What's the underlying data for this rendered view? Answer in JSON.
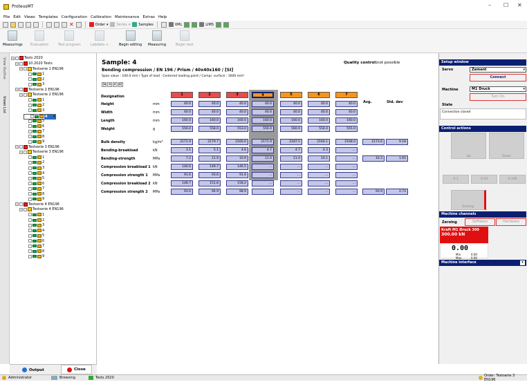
{
  "app": {
    "title": "ProteusMT",
    "window_controls": [
      "–",
      "☐",
      "✕"
    ]
  },
  "menu": [
    "File",
    "Edit",
    "Views",
    "Templates",
    "Configuration",
    "Calibration",
    "Maintenance",
    "Extras",
    "Help"
  ],
  "toolbar1": {
    "order": "Order",
    "series": "Series",
    "samples": "Samples",
    "xml": "XML",
    "lims": "LIMS"
  },
  "toolbar2": [
    {
      "label": "Measurings",
      "enabled": true
    },
    {
      "label": "Evaluation",
      "enabled": false
    },
    {
      "label": "Test program",
      "enabled": false
    },
    {
      "label": "Labdata +",
      "enabled": false
    },
    {
      "label": "Begin editing",
      "enabled": true
    },
    {
      "label": "Measuring",
      "enabled": true
    },
    {
      "label": "Begin test",
      "enabled": false
    }
  ],
  "side_tabs": {
    "view_outline": "View Outline",
    "views_list": "Views List"
  },
  "tree": {
    "root": "Tests 2020",
    "nodes": [
      {
        "label": "10.2020 Tests",
        "indent": 1,
        "kind": "red",
        "pm": "−"
      },
      {
        "label": "Testserie 1 EN196",
        "indent": 2,
        "kind": "yellow",
        "pm": "−"
      },
      {
        "label": "1",
        "indent": 3,
        "kind": "item"
      },
      {
        "label": "2",
        "indent": 3,
        "kind": "item"
      },
      {
        "label": "3",
        "indent": 3,
        "kind": "item"
      },
      {
        "label": "Testserie 2 EN196",
        "indent": 1,
        "kind": "red",
        "pm": "−"
      },
      {
        "label": "Testserie 2 EN196",
        "indent": 2,
        "kind": "yellow",
        "pm": "−"
      },
      {
        "label": "1",
        "indent": 3,
        "kind": "item"
      },
      {
        "label": "2",
        "indent": 3,
        "kind": "item"
      },
      {
        "label": "3",
        "indent": 3,
        "kind": "item"
      },
      {
        "label": "4",
        "indent": 3,
        "kind": "item",
        "selected": true
      },
      {
        "label": "5",
        "indent": 3,
        "kind": "item"
      },
      {
        "label": "6",
        "indent": 3,
        "kind": "item"
      },
      {
        "label": "7",
        "indent": 3,
        "kind": "item"
      },
      {
        "label": "8",
        "indent": 3,
        "kind": "item"
      },
      {
        "label": "9",
        "indent": 3,
        "kind": "item"
      },
      {
        "label": "Testserie 3 EN196",
        "indent": 1,
        "kind": "red",
        "pm": "−"
      },
      {
        "label": "Testserie 3 EN196",
        "indent": 2,
        "kind": "yellow",
        "pm": "−"
      },
      {
        "label": "1",
        "indent": 3,
        "kind": "item"
      },
      {
        "label": "2",
        "indent": 3,
        "kind": "item"
      },
      {
        "label": "3",
        "indent": 3,
        "kind": "item"
      },
      {
        "label": "4",
        "indent": 3,
        "kind": "item"
      },
      {
        "label": "5",
        "indent": 3,
        "kind": "item"
      },
      {
        "label": "6",
        "indent": 3,
        "kind": "item"
      },
      {
        "label": "7",
        "indent": 3,
        "kind": "item"
      },
      {
        "label": "8",
        "indent": 3,
        "kind": "item"
      },
      {
        "label": "9",
        "indent": 3,
        "kind": "item"
      },
      {
        "label": "Testserie 4 EN196",
        "indent": 1,
        "kind": "red",
        "pm": "−"
      },
      {
        "label": "Testserie 4 EN196",
        "indent": 2,
        "kind": "yellow",
        "pm": "−"
      },
      {
        "label": "1",
        "indent": 3,
        "kind": "item"
      },
      {
        "label": "2",
        "indent": 3,
        "kind": "item"
      },
      {
        "label": "3",
        "indent": 3,
        "kind": "item"
      },
      {
        "label": "4",
        "indent": 3,
        "kind": "item"
      },
      {
        "label": "5",
        "indent": 3,
        "kind": "item"
      },
      {
        "label": "6",
        "indent": 3,
        "kind": "item"
      },
      {
        "label": "7",
        "indent": 3,
        "kind": "item"
      },
      {
        "label": "8",
        "indent": 3,
        "kind": "item"
      },
      {
        "label": "9",
        "indent": 3,
        "kind": "item"
      }
    ]
  },
  "sample": {
    "title": "Sample: 4",
    "type": "Bending compression / EN 196 / Prism / 40x40x160 / [SI]",
    "span": "Span value : 100.0 mm / Type of load : Centered loading point / Compr. surface : 1600 mm²",
    "quality_label": "Quality control:",
    "quality_value": "not possible"
  },
  "grid": {
    "designation": "Designation",
    "columns": [
      "1",
      "2",
      "3",
      "4",
      "5",
      "6",
      "7"
    ],
    "column_colors": [
      "#e84c4c",
      "#e84c4c",
      "#e84c4c",
      "#f7941d",
      "#f7941d",
      "#f7941d",
      "#f7941d"
    ],
    "selected_column": 3,
    "avg_label": "Avg.",
    "std_label": "Std. dev",
    "rows": [
      {
        "name": "Height",
        "unit": "mm",
        "values": [
          "40.0",
          "40.0",
          "40.0",
          "40.0",
          "40.0",
          "40.0",
          "40.0"
        ],
        "avg": "",
        "std": ""
      },
      {
        "name": "Width",
        "unit": "mm",
        "values": [
          "40.0",
          "40.0",
          "40.0",
          "40.0",
          "40.0",
          "40.0",
          "40.0"
        ],
        "avg": "",
        "std": ""
      },
      {
        "name": "Length",
        "unit": "mm",
        "values": [
          "160.0",
          "160.0",
          "160.0",
          "160.0",
          "160.0",
          "160.0",
          "160.0"
        ],
        "avg": "",
        "std": ""
      },
      {
        "name": "Weight",
        "unit": "g",
        "values": [
          "556.0",
          "558.0",
          "553.0",
          "556.0",
          "560.0",
          "554.0",
          "555.0"
        ],
        "avg": "",
        "std": ""
      },
      {
        "name": "Bulk density",
        "unit": "kg/m³",
        "values": [
          "2171.9",
          "2179.7",
          "2160.0",
          "2171.9",
          "2187.5",
          "2164.1",
          "2168.0"
        ],
        "avg": "2173.6",
        "std": "9.18"
      },
      {
        "name": "Bending-breakload",
        "unit": "kN",
        "values": [
          "3.1",
          "5.1",
          "4.6",
          "4.7",
          "4.7",
          "4.3",
          "..."
        ],
        "avg": "",
        "std": ""
      },
      {
        "name": "Bending-strength",
        "unit": "MPa",
        "values": [
          "7.2",
          "11.9",
          "10.9",
          "11.0",
          "11.0",
          "10.1",
          "..."
        ],
        "avg": "10.3",
        "std": "1.65"
      },
      {
        "name": "Compression breakload 1",
        "unit": "kN",
        "values": [
          "146.6",
          "149.7",
          "146.5",
          "...",
          "...",
          "...",
          "..."
        ],
        "avg": "",
        "std": ""
      },
      {
        "name": "Compression strength 1",
        "unit": "MPa",
        "values": [
          "91.6",
          "93.6",
          "91.6",
          "...",
          "...",
          "...",
          "..."
        ],
        "avg": "",
        "std": ""
      },
      {
        "name": "Compression breakload 2",
        "unit": "kN",
        "values": [
          "148.7",
          "151.8",
          "158.2",
          "...",
          "...",
          "...",
          "..."
        ],
        "avg": "",
        "std": ""
      },
      {
        "name": "Compression strength 2",
        "unit": "MPa",
        "values": [
          "93.0",
          "94.9",
          "98.9",
          "...",
          "...",
          "...",
          "..."
        ],
        "avg": "93.9",
        "std": "2.73"
      }
    ]
  },
  "right": {
    "setup_header": "Setup window",
    "servo_label": "Servo",
    "servo_value": "Zement",
    "connect": "Connect",
    "machine_label": "Machine",
    "machine_value": "M1 Druck",
    "turn_on": "Turn On",
    "state_label": "State",
    "state_value": "Connection closed",
    "control_header": "Control actions",
    "up": "Up",
    "down": "Down",
    "step_buttons": [
      "0.1",
      "0.10",
      "0.100"
    ],
    "sinking": "Sinking",
    "channels_header": "Machine channels",
    "zeroing": "Zeroing",
    "software": "Software",
    "hardware": "Hardware",
    "channel_name": "Kraft M1 Druck 300",
    "channel_range": "300.00 kN",
    "readout": "0.00",
    "min_label": "Min",
    "min_value": "0.00",
    "max_label": "Max",
    "max_value": "0.00",
    "interface_header": "Machine interface"
  },
  "bottom_tabs": {
    "output": "Output",
    "close": "Close"
  },
  "statusbar": {
    "user": "Administrator",
    "mode": "Browsing",
    "context": "Tests 2020",
    "order": "Order: Testserie 3 EN196"
  }
}
